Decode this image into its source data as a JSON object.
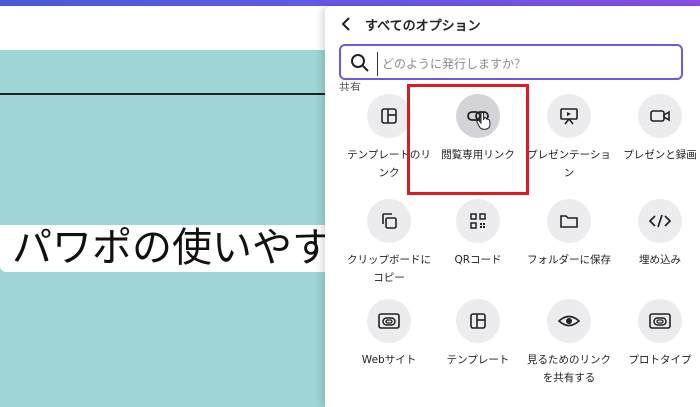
{
  "panel": {
    "title": "すべてのオプション",
    "search_placeholder": "どのように発行しますか？",
    "section_label": "共有",
    "options": [
      {
        "label": "テンプレートのリンク",
        "icon": "template-icon"
      },
      {
        "label": "閲覧専用リンク",
        "icon": "link-icon",
        "active": true
      },
      {
        "label": "プレゼンテーション",
        "icon": "presentation-icon"
      },
      {
        "label": "プレゼンと録画",
        "icon": "record-icon"
      },
      {
        "label": "クリップボードにコピー",
        "icon": "copy-icon"
      },
      {
        "label": "QRコード",
        "icon": "qr-icon"
      },
      {
        "label": "フォルダーに保存",
        "icon": "folder-icon"
      },
      {
        "label": "埋め込み",
        "icon": "embed-icon"
      },
      {
        "label": "Webサイト",
        "icon": "website-icon"
      },
      {
        "label": "テンプレート",
        "icon": "template-icon"
      },
      {
        "label": "見るためのリンクを共有する",
        "icon": "eye-icon"
      },
      {
        "label": "プロトタイプ",
        "icon": "prototype-icon"
      }
    ]
  },
  "slide": {
    "text": "パワポの使いやす"
  },
  "colors": {
    "accent": "#6e5bdc",
    "slide_bg": "#9ed6d7",
    "highlight": "#e11a22"
  }
}
